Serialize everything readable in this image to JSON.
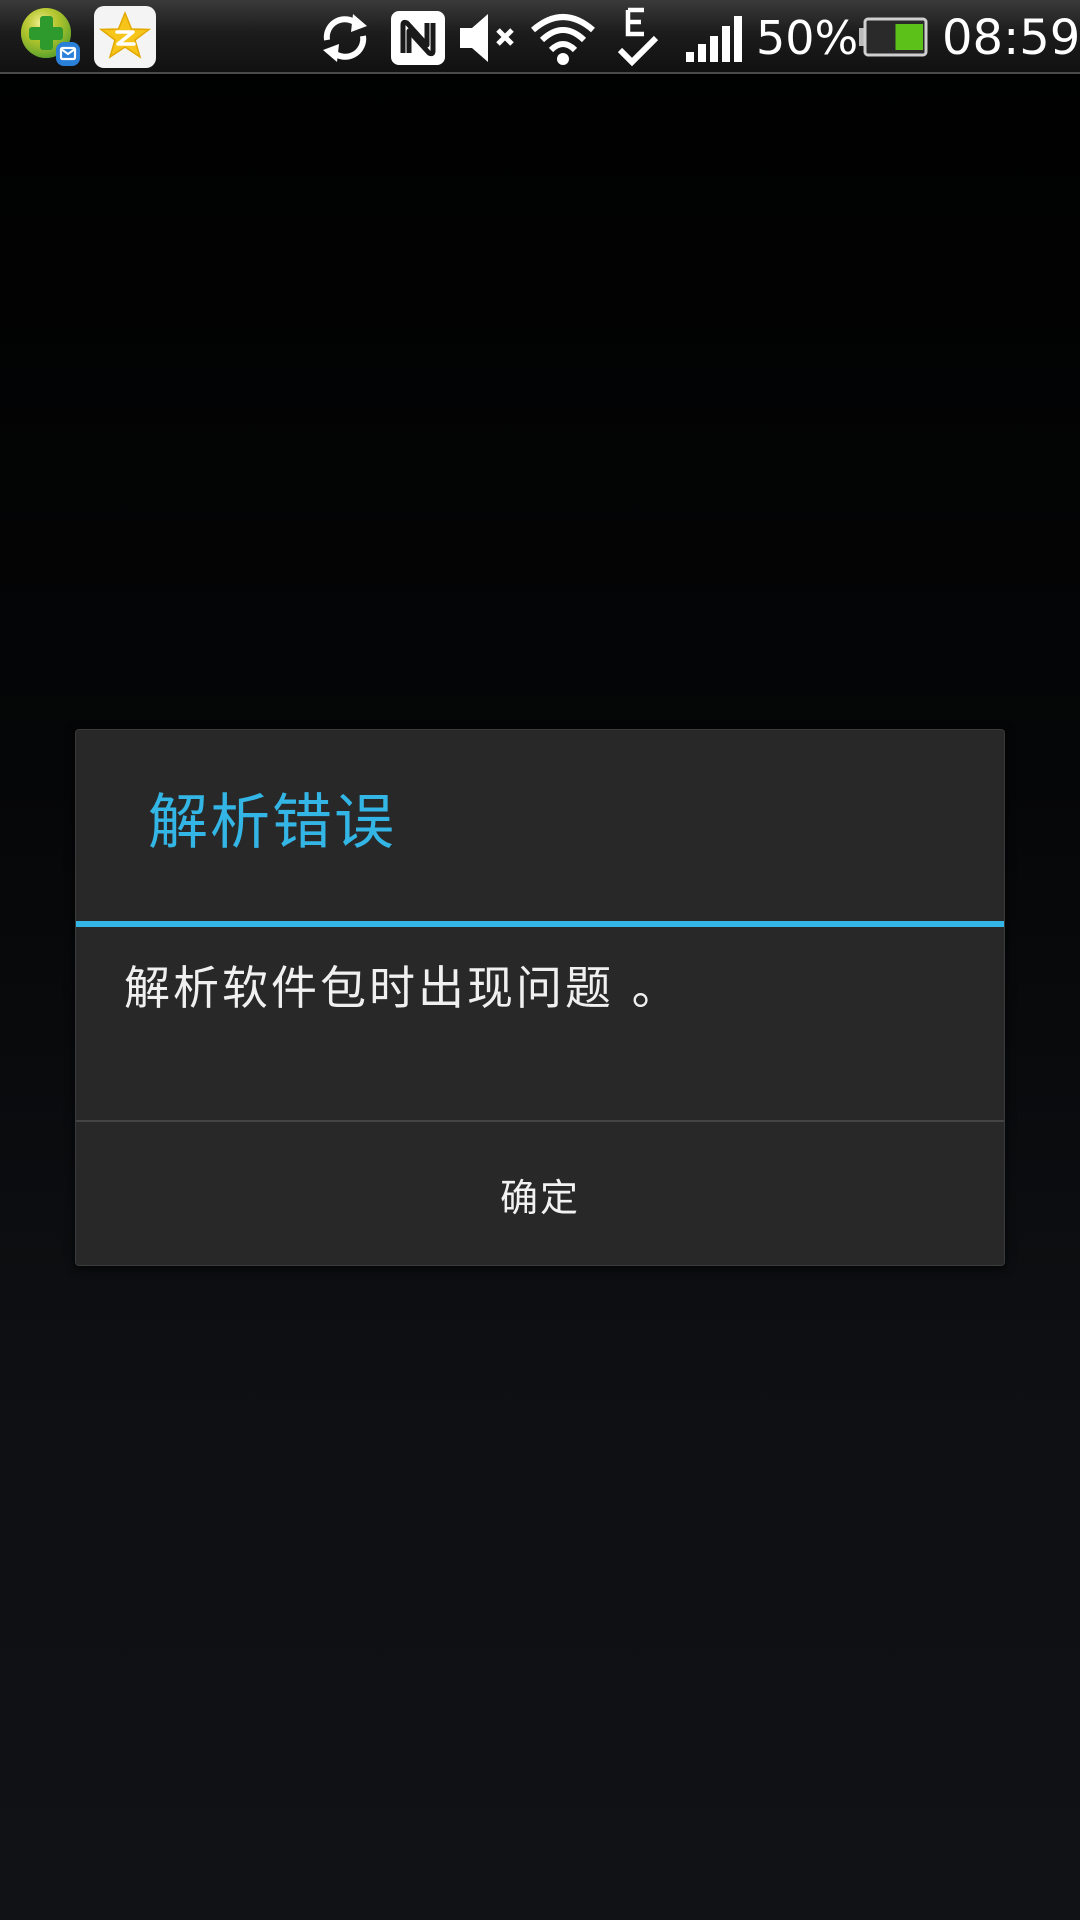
{
  "status_bar": {
    "notification_icons": [
      "health-plus-app-icon",
      "star-app-icon"
    ],
    "system_icons": [
      "sync-icon",
      "nfc-icon",
      "mute-icon",
      "wifi-icon",
      "edge-data-icon",
      "signal-icon",
      "battery-icon"
    ],
    "battery_percent": "50%",
    "battery_level": 0.5,
    "time": "08:59"
  },
  "dialog": {
    "title": "解析错误",
    "message": "解析软件包时出现问题 。",
    "ok_label": "确定"
  },
  "colors": {
    "accent": "#33b5e5",
    "dialog_bg": "#282828",
    "battery_fill": "#5cc21a"
  }
}
